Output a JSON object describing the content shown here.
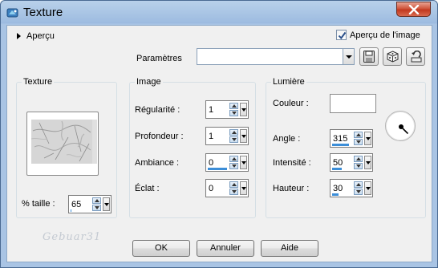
{
  "window": {
    "title": "Texture",
    "icon": "texture-app-icon"
  },
  "top": {
    "apercu_label": "Aperçu",
    "apercu_image_label": "Aperçu de l'image",
    "apercu_image_checked": true,
    "parametres_label": "Paramètres",
    "parametres_value": ""
  },
  "texture_group": {
    "title": "Texture",
    "taille_label": "% taille :",
    "taille_value": "65",
    "taille_fill": 0.05
  },
  "image_group": {
    "title": "Image",
    "fields": [
      {
        "label": "Régularité :",
        "value": "1",
        "fill": 0.0
      },
      {
        "label": "Profondeur :",
        "value": "1",
        "fill": 0.0
      },
      {
        "label": "Ambiance :",
        "value": "0",
        "fill": 1.0
      },
      {
        "label": "Éclat :",
        "value": "0",
        "fill": 0.0
      }
    ]
  },
  "lumiere_group": {
    "title": "Lumière",
    "couleur_label": "Couleur :",
    "couleur_value": "#ffffff",
    "fields": [
      {
        "label": "Angle :",
        "value": "315",
        "fill": 0.88
      },
      {
        "label": "Intensité :",
        "value": "50",
        "fill": 0.5
      },
      {
        "label": "Hauteur :",
        "value": "30",
        "fill": 0.33
      }
    ]
  },
  "buttons": {
    "ok": "OK",
    "annuler": "Annuler",
    "aide": "Aide"
  },
  "watermark": "Gebuar31",
  "colors": {
    "accent": "#3c8ed8",
    "titlebar": "#9dbbe0",
    "close": "#c2381f"
  }
}
